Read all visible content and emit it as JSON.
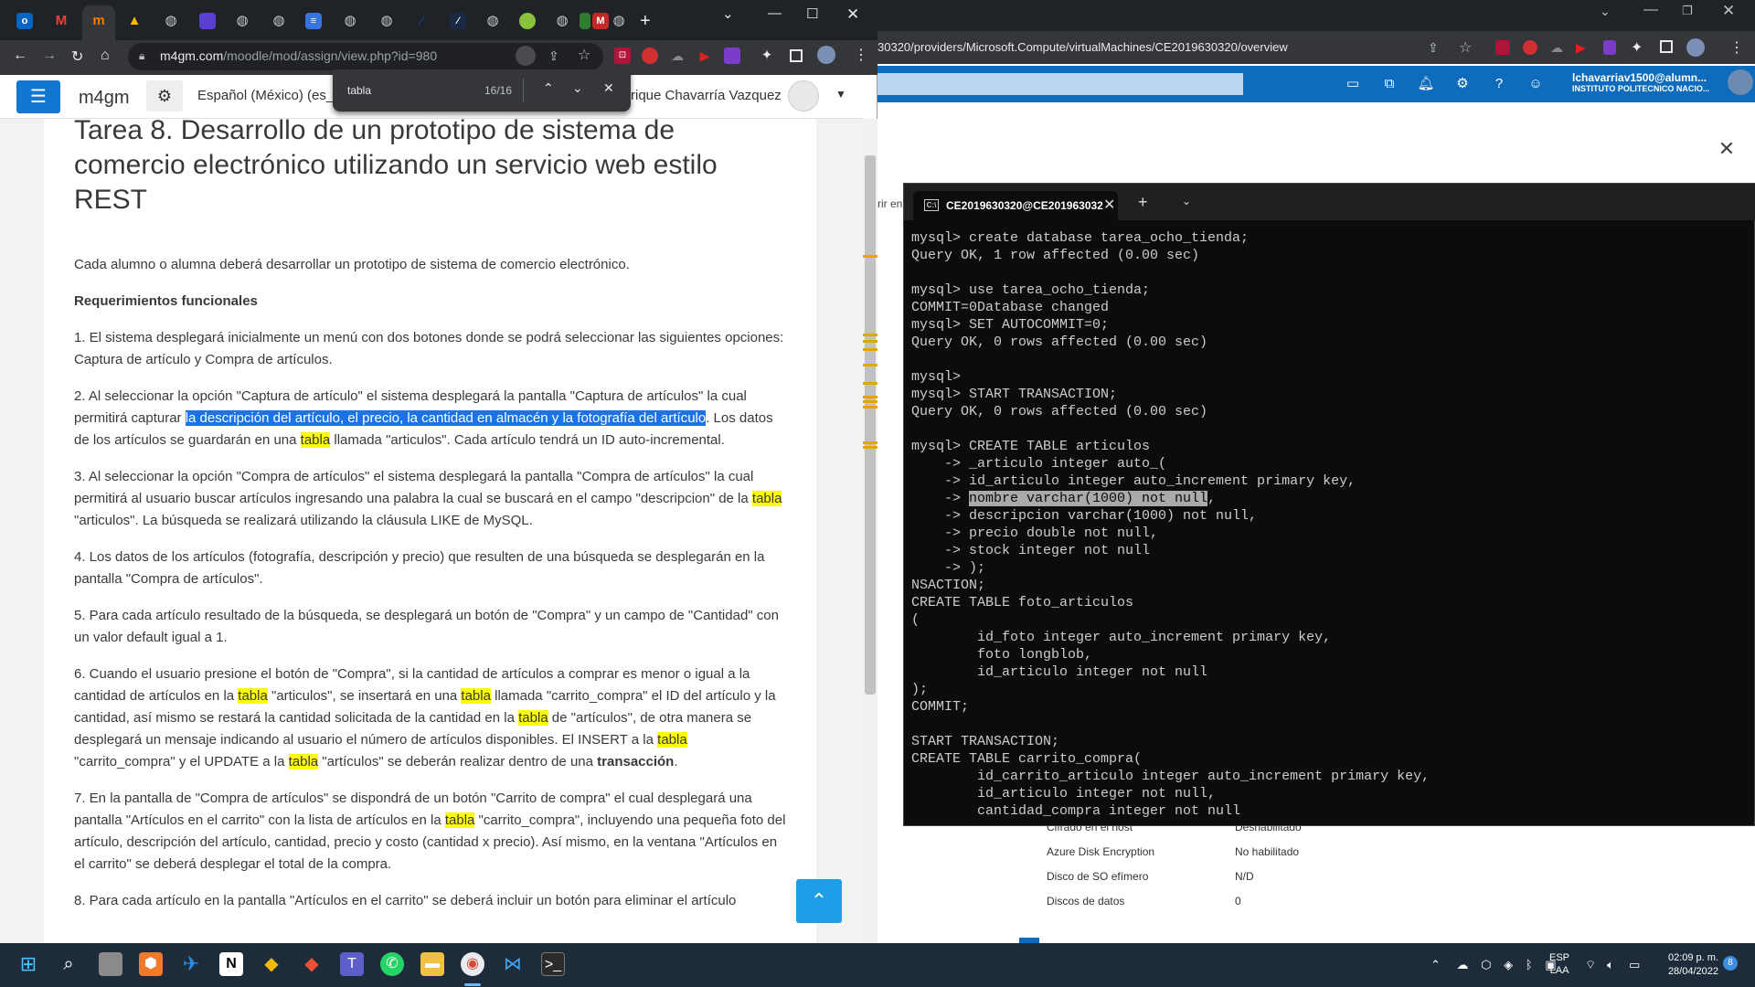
{
  "right_window": {
    "url": "30320/providers/Microsoft.Compute/virtualMachines/CE2019630320/overview",
    "user_name": "lchavarriav1500@alumn...",
    "user_org": "INSTITUTO POLITECNICO NACIO...",
    "side_text": "rir en",
    "properties": [
      {
        "key": "Cifrado en el host",
        "value": "Deshabilitado"
      },
      {
        "key": "Azure Disk Encryption",
        "value": "No habilitado"
      },
      {
        "key": "Disco de SO efímero",
        "value": "N/D"
      },
      {
        "key": "Discos de datos",
        "value": "0"
      }
    ],
    "icons": [
      "console-icon",
      "directory-icon",
      "bell-icon",
      "gear-icon",
      "help-icon",
      "feedback-icon"
    ],
    "brand_color": "#0f6cbd"
  },
  "terminal": {
    "tab_title": "CE2019630320@CE201963032",
    "lines_before_hl": "mysql> create database tarea_ocho_tienda;\nQuery OK, 1 row affected (0.00 sec)\n\nmysql> use tarea_ocho_tienda;\nCOMMIT=0Database changed\nmysql> SET AUTOCOMMIT=0;\nQuery OK, 0 rows affected (0.00 sec)\n\nmysql>\nmysql> START TRANSACTION;\nQuery OK, 0 rows affected (0.00 sec)\n\nmysql> CREATE TABLE articulos\n    -> _articulo integer auto_(\n    -> id_articulo integer auto_increment primary key,\n    -> ",
    "highlighted": "nombre varchar(1000) not null",
    "lines_after_hl": ",\n    -> descripcion varchar(1000) not null,\n    -> precio double not null,\n    -> stock integer not null\n    -> );\nNSACTION;\nCREATE TABLE foto_articulos\n(\n        id_foto integer auto_increment primary key,\n        foto longblob,\n        id_articulo integer not null\n);\nCOMMIT;\n\nSTART TRANSACTION;\nCREATE TABLE carrito_compra(\n        id_carrito_articulo integer auto_increment primary key,\n        id_articulo integer not null,\n        cantidad_compra integer not null"
  },
  "left_window": {
    "url_host": "m4gm.com",
    "url_path": "/moodle/mod/assign/view.php?id=980",
    "new_tab": "+",
    "tab_badge": "M",
    "brand": "m4gm",
    "language": "Español (México) (es_",
    "user": "rique Chavarría Vazquez",
    "find": {
      "query": "tabla",
      "count": "16/16"
    },
    "title": "Tarea 8. Desarrollo de un prototipo de sistema de comercio electrónico utilizando un servicio web estilo REST",
    "intro": "Cada alumno o alumna deberá desarrollar un prototipo de sistema de comercio electrónico.",
    "req_heading": "Requerimientos funcionales",
    "p1": "1. El sistema desplegará inicialmente un menú con dos botones donde se podrá seleccionar las siguientes opciones: Captura de artículo y Compra de artículos.",
    "p2a": "2. Al seleccionar la opción \"Captura de artículo\" el sistema desplegará la pantalla \"Captura de artículos\" la cual permitirá capturar ",
    "p2sel": "la descripción del artículo, el precio, la cantidad en almacén y la fotografía del artículo",
    "p2b": ". Los datos de los artículos se guardarán en una ",
    "hl_word": "tabla",
    "p2c": " llamada \"articulos\". Cada artículo tendrá un ID auto-incremental.",
    "p3a": "3. Al seleccionar la opción \"Compra de artículos\" el sistema desplegará la pantalla \"Compra de artículos\" la cual permitirá al usuario buscar artículos ingresando una palabra la cual se buscará en el campo \"descripcion\" de la ",
    "p3b": " \"articulos\". La búsqueda se realizará utilizando la cláusula LIKE de MySQL.",
    "p4": "4. Los datos de los artículos (fotografía, descripción y precio) que resulten de una búsqueda se desplegarán en la pantalla \"Compra de artículos\".",
    "p5": "5. Para cada artículo resultado de la búsqueda, se desplegará un botón de \"Compra\" y un campo de \"Cantidad\" con un valor default igual a 1.",
    "p6a": "6. Cuando el usuario presione el botón de \"Compra\", si la cantidad de artículos a comprar es menor o igual a la cantidad de artículos en la ",
    "p6b": " \"articulos\", se insertará en una ",
    "p6c": " llamada \"carrito_compra\" el ID del artículo y la cantidad, así mismo se restará la cantidad solicitada de la cantidad en la ",
    "p6d": " de \"artículos\", de otra manera se desplegará un mensaje indicando al usuario el número de artículos disponibles. El INSERT a la ",
    "p6e": " \"carrito_compra\" y el UPDATE a la ",
    "p6f": " \"artículos\" se deberán realizar dentro de una ",
    "p6bold": "transacción",
    "p6end": ".",
    "p7a": "7. En la pantalla de \"Compra de artículos\" se dispondrá de un botón \"Carrito de compra\" el cual desplegará una pantalla \"Artículos en el carrito\" con la lista de artículos en la ",
    "p7b": " \"carrito_compra\", incluyendo una pequeña foto del artículo, descripción del artículo, cantidad, precio y costo (cantidad x precio). Así mismo, en la ventana \"Artículos en el carrito\" se deberá desplegar el total de la compra.",
    "p8": "8. Para cada artículo en la pantalla \"Artículos en el carrito\" se deberá incluir un botón para eliminar el artículo"
  },
  "taskbar": {
    "lang_top": "ESP",
    "lang_bottom": "LAA",
    "time": "02:09 p. m.",
    "date": "28/04/2022",
    "notif_count": "8"
  },
  "colors": {
    "find_highlight": "#ffff00",
    "selection": "#1a73e8",
    "moodle_blue": "#1177d1",
    "terminal_bg": "#0c0c0c"
  }
}
